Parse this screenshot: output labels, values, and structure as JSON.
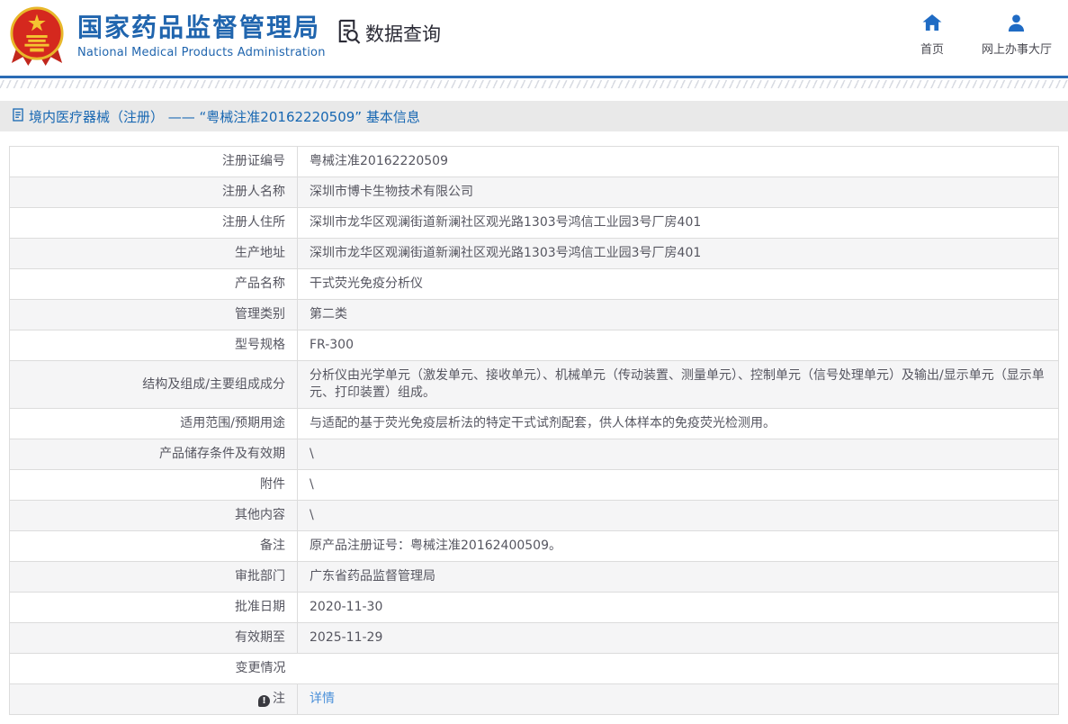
{
  "header": {
    "logo_icon": "national-emblem-icon",
    "title_cn": "国家药品监督管理局",
    "title_en": "National Medical Products Administration",
    "section": {
      "icon": "document-search-icon",
      "label": "数据查询"
    },
    "nav": [
      {
        "icon": "home-icon",
        "label": "首页"
      },
      {
        "icon": "user-icon",
        "label": "网上办事大厅"
      }
    ]
  },
  "breadcrumb": {
    "icon": "document-icon",
    "text": "境内医疗器械（注册） —— “粤械注准20162220509” 基本信息"
  },
  "table": {
    "rows": [
      {
        "label": "注册证编号",
        "value": "粤械注准20162220509"
      },
      {
        "label": "注册人名称",
        "value": "深圳市博卡生物技术有限公司"
      },
      {
        "label": "注册人住所",
        "value": "深圳市龙华区观澜街道新澜社区观光路1303号鸿信工业园3号厂房401"
      },
      {
        "label": "生产地址",
        "value": "深圳市龙华区观澜街道新澜社区观光路1303号鸿信工业园3号厂房401"
      },
      {
        "label": "产品名称",
        "value": "干式荧光免疫分析仪"
      },
      {
        "label": "管理类别",
        "value": "第二类"
      },
      {
        "label": "型号规格",
        "value": "FR-300"
      },
      {
        "label": "结构及组成/主要组成成分",
        "value": "分析仪由光学单元（激发单元、接收单元）、机械单元（传动装置、测量单元）、控制单元（信号处理单元）及输出/显示单元（显示单元、打印装置）组成。"
      },
      {
        "label": "适用范围/预期用途",
        "value": "与适配的基于荧光免疫层析法的特定干式试剂配套，供人体样本的免疫荧光检测用。"
      },
      {
        "label": "产品储存条件及有效期",
        "value": "\\"
      },
      {
        "label": "附件",
        "value": "\\"
      },
      {
        "label": "其他内容",
        "value": "\\"
      },
      {
        "label": "备注",
        "value": "原产品注册证号：粤械注准20162400509。"
      },
      {
        "label": "审批部门",
        "value": "广东省药品监督管理局"
      },
      {
        "label": "批准日期",
        "value": "2020-11-30"
      },
      {
        "label": "有效期至",
        "value": "2025-11-29"
      },
      {
        "label": "变更情况",
        "value": "",
        "no_divider": true
      },
      {
        "label": "注",
        "label_icon": "note-icon",
        "value": "详情",
        "value_is_link": true
      }
    ]
  },
  "colors": {
    "brand_blue": "#2065ae",
    "rule_blue": "#2b6cb5",
    "crumb_bg": "#e9e9e9",
    "crumb_text": "#1767b2",
    "row_alt_bg": "#f5f5f6",
    "border": "#dcdcdc",
    "link": "#4a90d9",
    "text": "#565660"
  }
}
